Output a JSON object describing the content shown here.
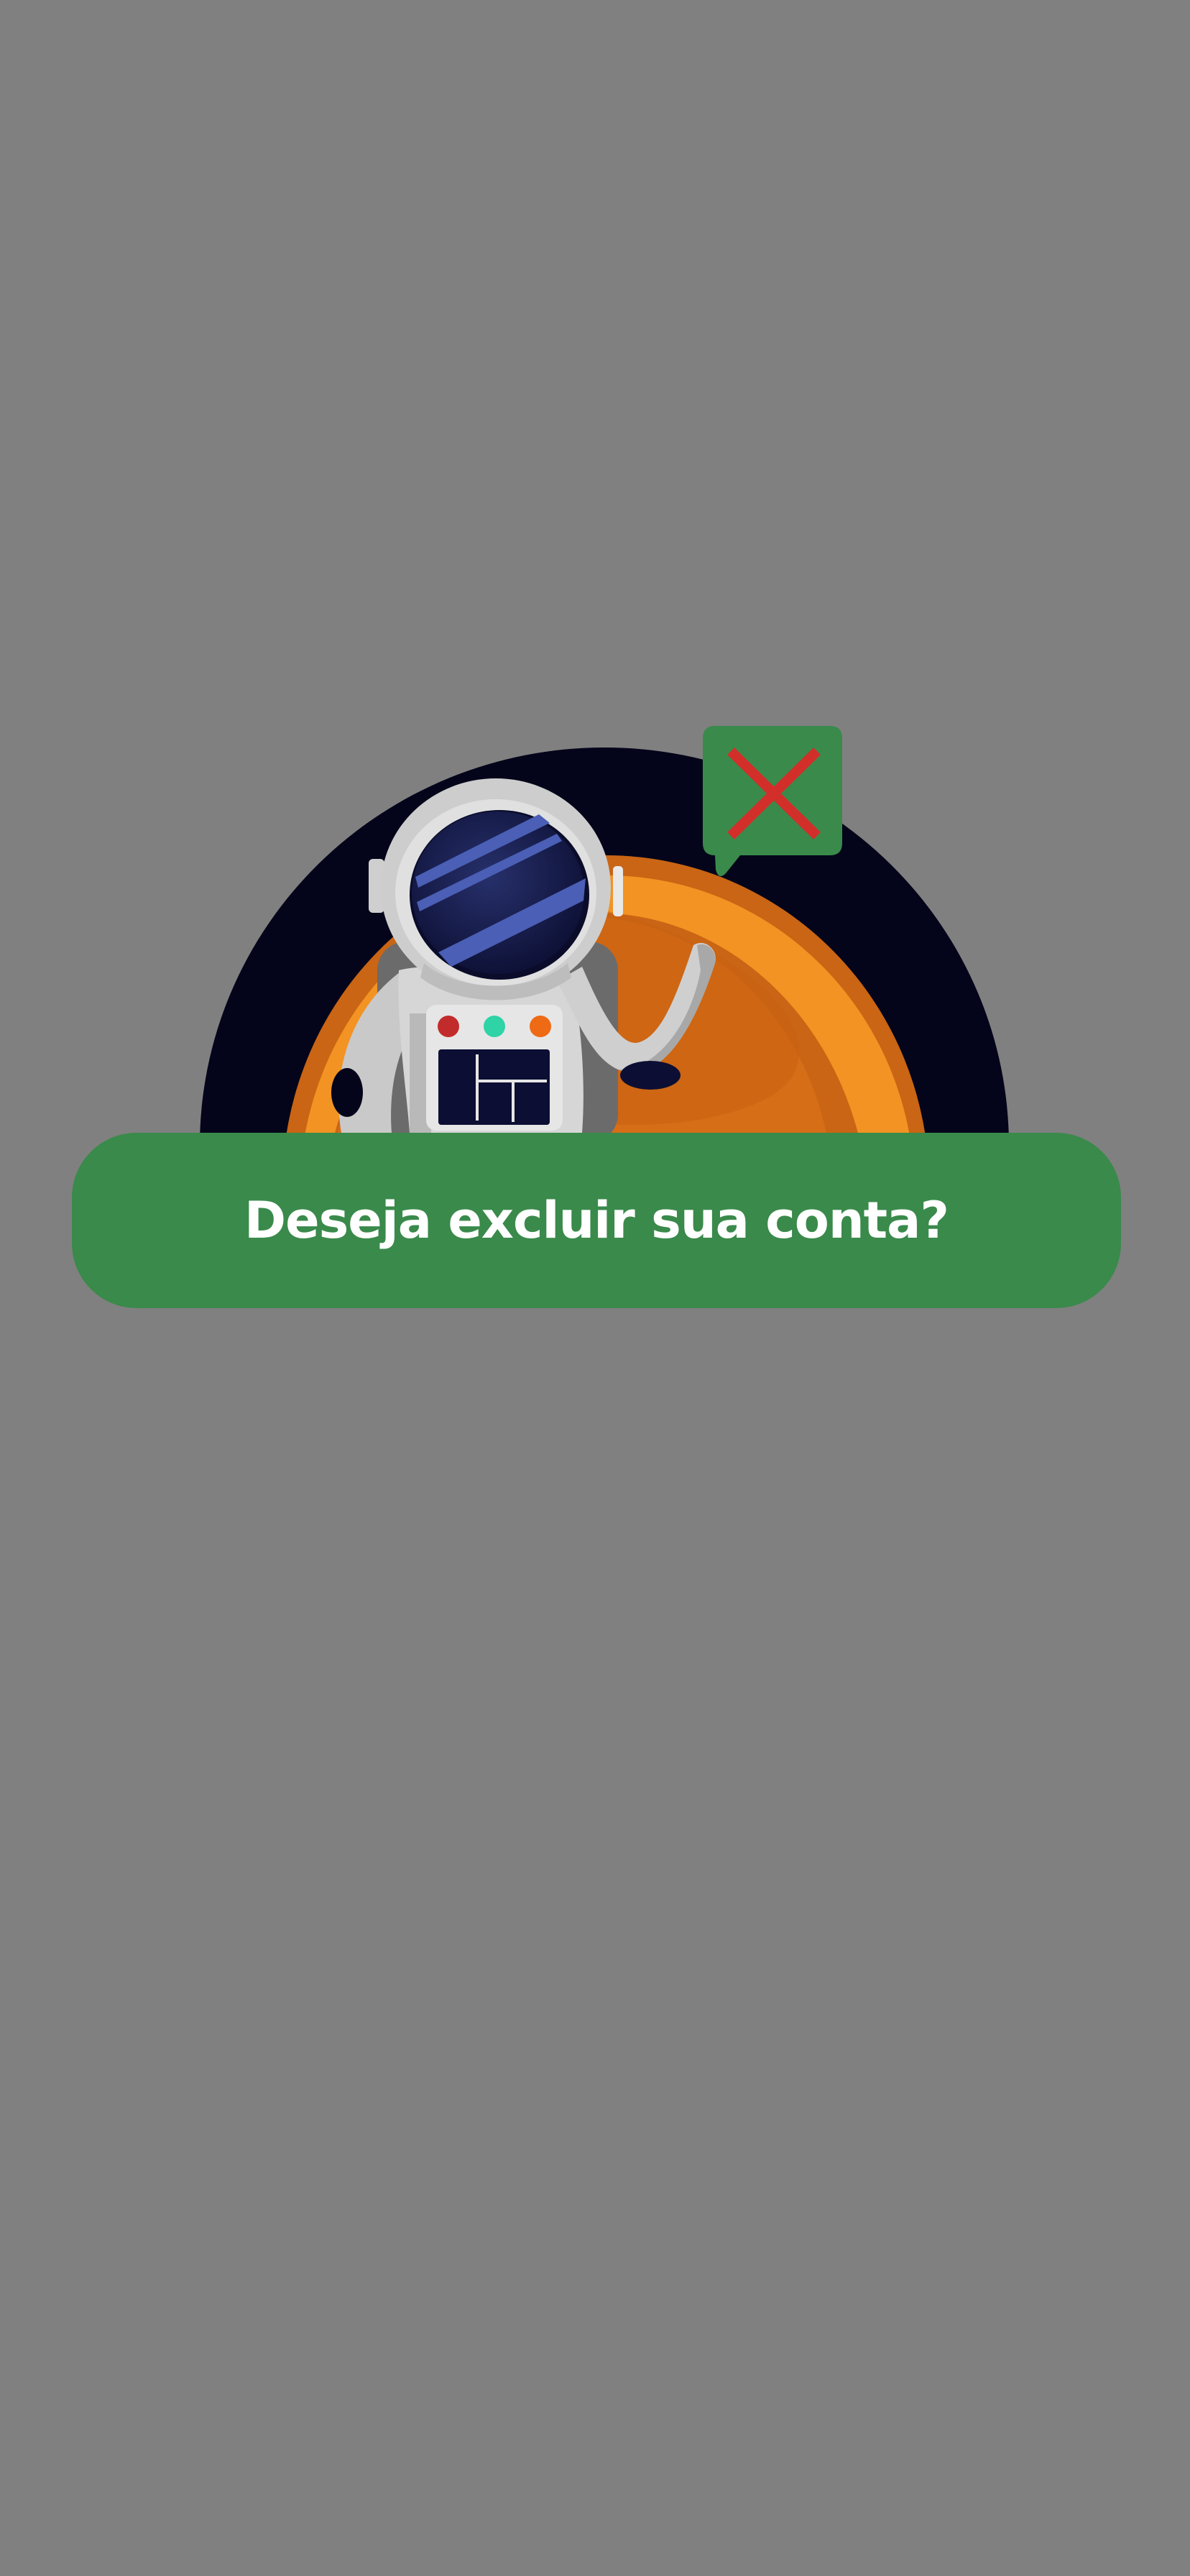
{
  "dialog": {
    "question": "Deseja excluir sua conta?"
  },
  "illustration": {
    "subject": "astronaut-icon",
    "badge_icon": "close-icon",
    "colors": {
      "space": "#04051a",
      "planet": "#f29323",
      "planet_dark": "#d46d17",
      "badge": "#3a8a4b",
      "cross": "#d22f2a",
      "suit": "#cfcfcf",
      "visor": "#15184a"
    }
  },
  "theme": {
    "background": "#808080",
    "banner": "#3a8a4b",
    "banner_text": "#ffffff"
  }
}
